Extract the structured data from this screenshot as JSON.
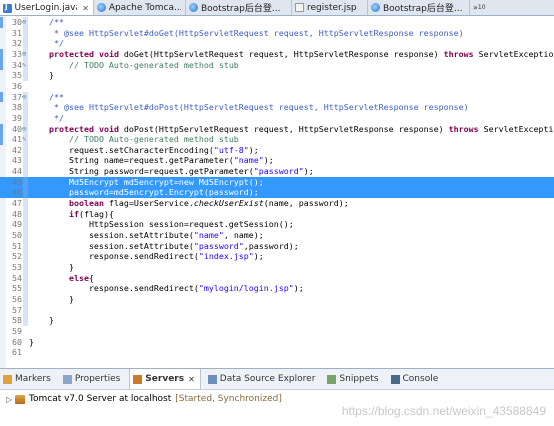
{
  "tabs": [
    {
      "label": "UserLogin.java",
      "icon": "java-file-icon",
      "closable": true,
      "active": true
    },
    {
      "label": "Apache Tomca...",
      "icon": "globe-icon",
      "closable": false,
      "active": false
    },
    {
      "label": "Bootstrap后台登...",
      "icon": "globe-icon",
      "closable": false,
      "active": false
    },
    {
      "label": "register.jsp",
      "icon": "jsp-file-icon",
      "closable": false,
      "active": false
    },
    {
      "label": "Bootstrap后台登...",
      "icon": "globe-icon",
      "closable": false,
      "active": false
    }
  ],
  "tab_close_glyph": "✕",
  "tab_overflow": {
    "glyph": "»",
    "count": "10"
  },
  "editor": {
    "lines": [
      {
        "n": "30",
        "marker": "⊖",
        "html": "    <span class='jd'>/**</span>"
      },
      {
        "n": "31",
        "html": "     <span class='jd'>* @see HttpServlet#doGet(HttpServletRequest request, HttpServletResponse response)</span>"
      },
      {
        "n": "32",
        "html": "     <span class='jd'>*/</span>"
      },
      {
        "n": "33",
        "marker": "⊖",
        "html": "    <span class='kw'>protected</span> <span class='kw'>void</span> doGet(HttpServletRequest request, HttpServletResponse response) <span class='kw'>throws</span> ServletException, IOException {"
      },
      {
        "n": "34",
        "marker": "✎",
        "html": "        <span class='cm'>// TODO Auto-generated method stub</span>"
      },
      {
        "n": "35",
        "html": "    }"
      },
      {
        "n": "36",
        "html": ""
      },
      {
        "n": "37",
        "marker": "⊖",
        "html": "    <span class='jd'>/**</span>"
      },
      {
        "n": "38",
        "html": "     <span class='jd'>* @see HttpServlet#doPost(HttpServletRequest request, HttpServletResponse response)</span>"
      },
      {
        "n": "39",
        "html": "     <span class='jd'>*/</span>"
      },
      {
        "n": "40",
        "marker": "⊖",
        "html": "    <span class='kw'>protected</span> <span class='kw'>void</span> doPost(HttpServletRequest request, HttpServletResponse response) <span class='kw'>throws</span> ServletException, IOException {"
      },
      {
        "n": "41",
        "marker": "✎",
        "html": "        <span class='cm'>// TODO Auto-generated method stub</span>"
      },
      {
        "n": "42",
        "html": "        request.setCharacterEncoding(<span class='str'>\"utf-8\"</span>);"
      },
      {
        "n": "43",
        "html": "        String name=request.getParameter(<span class='str'>\"name\"</span>);"
      },
      {
        "n": "44",
        "html": "        String password=request.getParameter(<span class='str'>\"password\"</span>);"
      },
      {
        "n": "45",
        "selected": true,
        "html": "        Md5Encrypt md5encrypt=new Md5Encrypt();"
      },
      {
        "n": "46",
        "selected": true,
        "html": "        password=md5encrypt.Encrypt(password);"
      },
      {
        "n": "47",
        "html": "        <span class='kw'>boolean</span> flag=UserService.<span class='it'>checkUserExist</span>(name, password);"
      },
      {
        "n": "48",
        "html": "        <span class='kw'>if</span>(flag){"
      },
      {
        "n": "49",
        "html": "            HttpSession session=request.getSession();"
      },
      {
        "n": "50",
        "html": "            session.setAttribute(<span class='str'>\"name\"</span>, name);"
      },
      {
        "n": "51",
        "html": "            session.setAttribute(<span class='str'>\"password\"</span>,password);"
      },
      {
        "n": "52",
        "html": "            response.sendRedirect(<span class='str'>\"index.jsp\"</span>);"
      },
      {
        "n": "53",
        "html": "        }"
      },
      {
        "n": "54",
        "html": "        <span class='kw'>else</span>{"
      },
      {
        "n": "55",
        "html": "            response.sendRedirect(<span class='str'>\"mylogin/login.jsp\"</span>);"
      },
      {
        "n": "56",
        "html": "        }"
      },
      {
        "n": "57",
        "html": ""
      },
      {
        "n": "58",
        "html": "    }"
      },
      {
        "n": "59",
        "html": ""
      },
      {
        "n": "60",
        "html": "}"
      },
      {
        "n": "61",
        "html": ""
      }
    ]
  },
  "bottom_tabs": [
    {
      "label": "Markers",
      "icon": "markers-icon",
      "active": false
    },
    {
      "label": "Properties",
      "icon": "properties-icon",
      "active": false
    },
    {
      "label": "Servers",
      "icon": "servers-icon",
      "active": true
    },
    {
      "label": "Data Source Explorer",
      "icon": "data-source-icon",
      "active": false
    },
    {
      "label": "Snippets",
      "icon": "snippets-icon",
      "active": false
    },
    {
      "label": "Console",
      "icon": "console-icon",
      "active": false
    }
  ],
  "active_tab_close_glyph": "✕",
  "server": {
    "name": "Tomcat v7.0 Server at localhost",
    "status": "[Started, Synchronized]"
  },
  "watermark": "https://blog.csdn.net/weixin_43588849",
  "colors": {
    "selection": "#3399ff",
    "keyword": "#7f0055",
    "comment": "#3f7f5f",
    "javadoc": "#3f5fbf",
    "string": "#2a00ff"
  }
}
